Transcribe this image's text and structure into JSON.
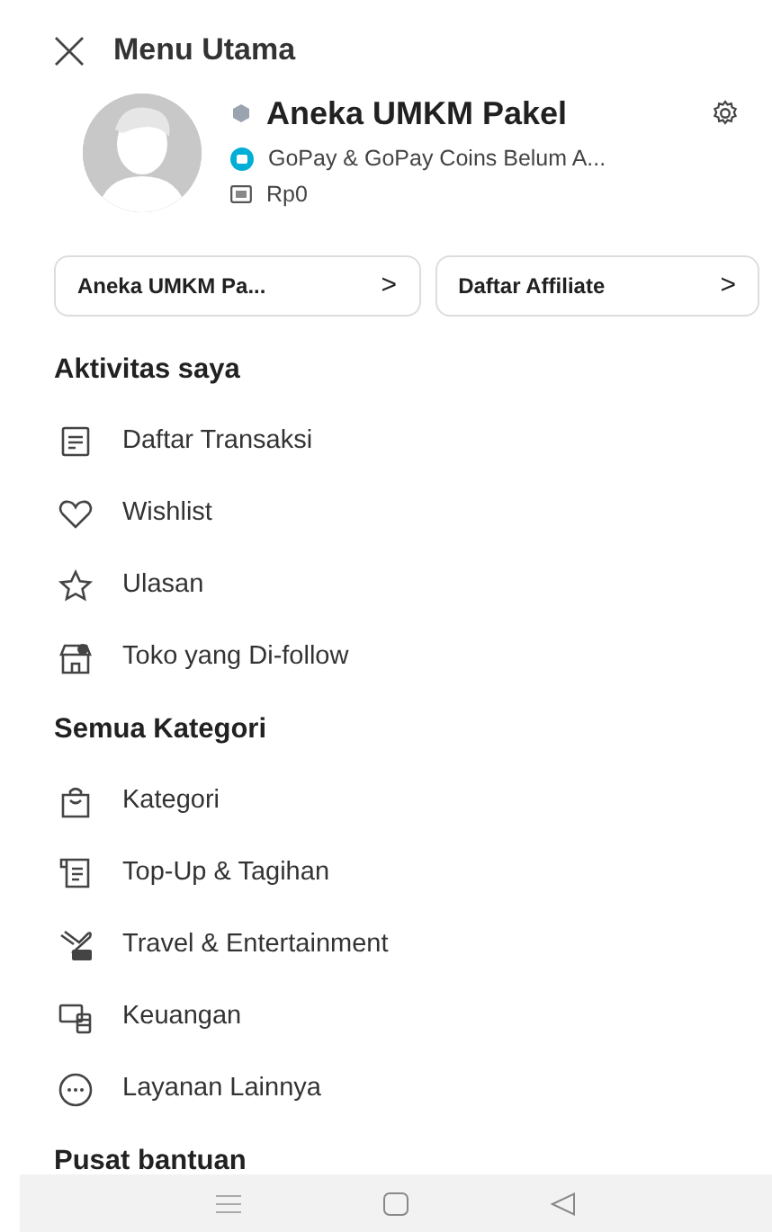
{
  "header": {
    "title": "Menu Utama"
  },
  "profile": {
    "name": "Aneka UMKM Pakel",
    "gopay": "GoPay & GoPay Coins Belum A...",
    "balance": "Rp0"
  },
  "shortcuts": [
    {
      "label": "Aneka UMKM Pa...",
      "arrow": ">"
    },
    {
      "label": "Daftar Affiliate",
      "arrow": ">"
    }
  ],
  "sections": [
    {
      "title": "Aktivitas saya",
      "items": [
        {
          "label": "Daftar Transaksi"
        },
        {
          "label": "Wishlist"
        },
        {
          "label": "Ulasan"
        },
        {
          "label": "Toko yang Di-follow"
        }
      ]
    },
    {
      "title": "Semua Kategori",
      "items": [
        {
          "label": "Kategori"
        },
        {
          "label": "Top-Up & Tagihan"
        },
        {
          "label": "Travel & Entertainment"
        },
        {
          "label": "Keuangan"
        },
        {
          "label": "Layanan Lainnya"
        }
      ]
    },
    {
      "title": "Pusat bantuan"
    }
  ]
}
